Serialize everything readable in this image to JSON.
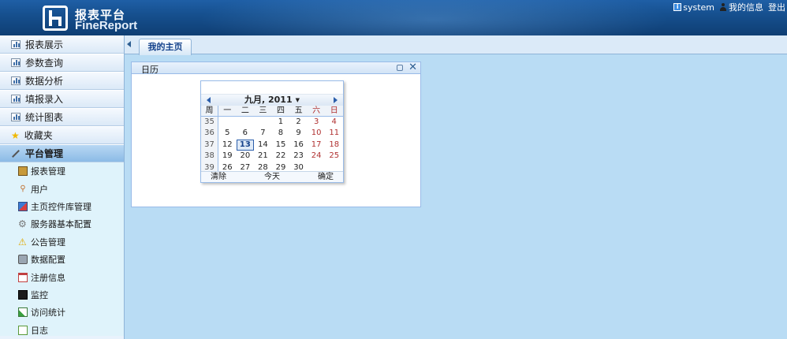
{
  "header": {
    "logo_title": "报表平台",
    "logo_subtitle": "FineReport",
    "nav": [
      {
        "label": "system",
        "icon": "system-icon"
      },
      {
        "label": "我的信息",
        "icon": "user-icon"
      },
      {
        "label": "登出",
        "icon": ""
      }
    ]
  },
  "sidebar": {
    "items": [
      {
        "label": "报表展示",
        "icon": "bar-chart-icon"
      },
      {
        "label": "参数查询",
        "icon": "bar-chart-icon"
      },
      {
        "label": "数据分析",
        "icon": "bar-chart-icon"
      },
      {
        "label": "填报录入",
        "icon": "bar-chart-icon"
      },
      {
        "label": "统计图表",
        "icon": "bar-chart-icon"
      },
      {
        "label": "收藏夹",
        "icon": "star-icon"
      },
      {
        "label": "平台管理",
        "icon": "wrench-icon",
        "active": true
      }
    ],
    "sub_items": [
      {
        "label": "报表管理",
        "icon": "report-manage-icon"
      },
      {
        "label": "用户",
        "icon": "user-icon"
      },
      {
        "label": "主页控件库管理",
        "icon": "widget-library-icon"
      },
      {
        "label": "服务器基本配置",
        "icon": "gear-icon"
      },
      {
        "label": "公告管理",
        "icon": "warning-icon"
      },
      {
        "label": "数据配置",
        "icon": "database-icon"
      },
      {
        "label": "注册信息",
        "icon": "calendar-icon"
      },
      {
        "label": "监控",
        "icon": "monitor-icon"
      },
      {
        "label": "访问统计",
        "icon": "statistics-icon"
      },
      {
        "label": "日志",
        "icon": "log-icon"
      }
    ]
  },
  "tabs": [
    {
      "label": "我的主页",
      "active": true
    }
  ],
  "panel": {
    "title": "日历",
    "close_glyph": "✕"
  },
  "calendar": {
    "month_label": "九月, 2011",
    "dropdown_glyph": "▼",
    "week_header": "周",
    "weekdays": [
      "一",
      "二",
      "三",
      "四",
      "五",
      "六",
      "日"
    ],
    "weeks": [
      {
        "num": "35",
        "days": [
          "",
          "",
          "",
          "1",
          "2",
          "3",
          "4"
        ]
      },
      {
        "num": "36",
        "days": [
          "5",
          "6",
          "7",
          "8",
          "9",
          "10",
          "11"
        ]
      },
      {
        "num": "37",
        "days": [
          "12",
          "13",
          "14",
          "15",
          "16",
          "17",
          "18"
        ]
      },
      {
        "num": "38",
        "days": [
          "19",
          "20",
          "21",
          "22",
          "23",
          "24",
          "25"
        ]
      },
      {
        "num": "39",
        "days": [
          "26",
          "27",
          "28",
          "29",
          "30",
          "",
          ""
        ]
      }
    ],
    "today": "13",
    "footer": {
      "clear": "清除",
      "today": "今天",
      "ok": "确定"
    }
  },
  "colors": {
    "header_bg": "#16508f",
    "weekend": "#b03030",
    "main_bg": "#b9dcf4"
  }
}
